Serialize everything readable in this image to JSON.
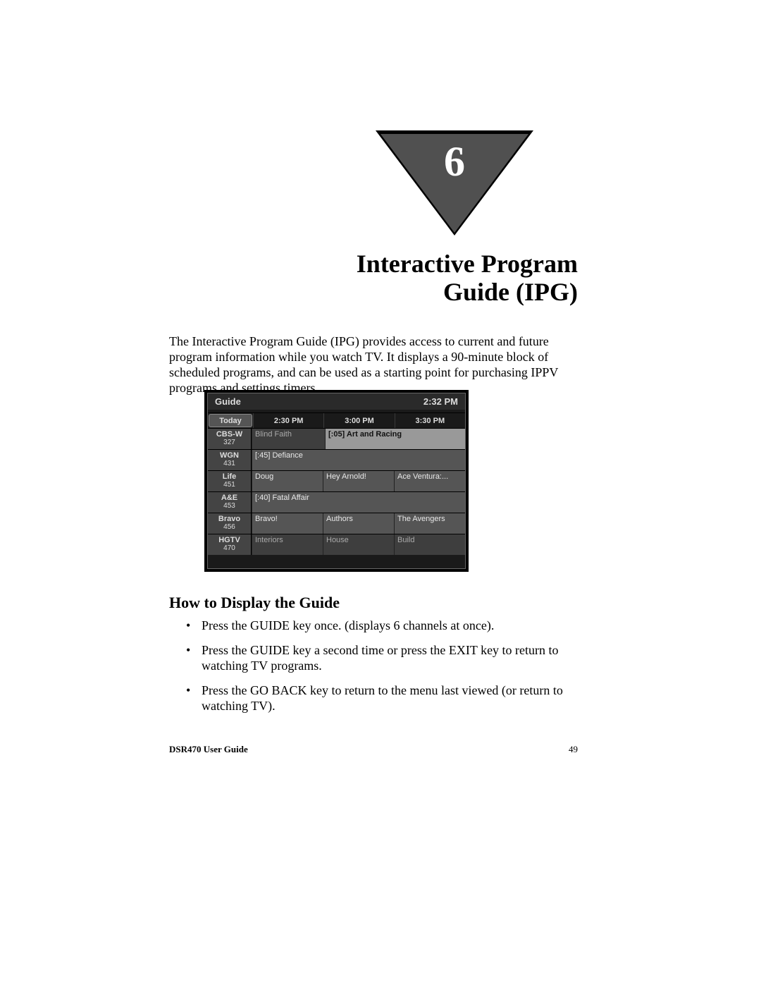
{
  "chapter": {
    "number": "6",
    "title_line1": "Interactive Program",
    "title_line2": "Guide (IPG)"
  },
  "intro_paragraph": "The Interactive Program Guide (IPG) provides access to current and future program information while you watch TV. It displays a 90-minute block of scheduled programs, and can be used as a starting point for purchasing IPPV programs and settings timers.",
  "guide": {
    "title": "Guide",
    "clock": "2:32 PM",
    "today_label": "Today",
    "time_headers": [
      "2:30 PM",
      "3:00 PM",
      "3:30 PM"
    ],
    "channels": [
      {
        "name": "CBS-W",
        "num": "327",
        "programs": [
          {
            "title": "Blind Faith",
            "span": 1,
            "style": "dim"
          },
          {
            "title": "[:05] Art and Racing",
            "span": 2,
            "style": "hilite"
          }
        ]
      },
      {
        "name": "WGN",
        "num": "431",
        "programs": [
          {
            "title": "[:45] Defiance",
            "span": 3,
            "style": ""
          }
        ]
      },
      {
        "name": "Life",
        "num": "451",
        "programs": [
          {
            "title": "Doug",
            "span": 1,
            "style": ""
          },
          {
            "title": "Hey Arnold!",
            "span": 1,
            "style": ""
          },
          {
            "title": "Ace Ventura:...",
            "span": 1,
            "style": ""
          }
        ]
      },
      {
        "name": "A&E",
        "num": "453",
        "programs": [
          {
            "title": "[:40] Fatal Affair",
            "span": 3,
            "style": ""
          }
        ]
      },
      {
        "name": "Bravo",
        "num": "456",
        "programs": [
          {
            "title": "Bravo!",
            "span": 1,
            "style": ""
          },
          {
            "title": "Authors",
            "span": 1,
            "style": ""
          },
          {
            "title": "The Avengers",
            "span": 1,
            "style": ""
          }
        ]
      },
      {
        "name": "HGTV",
        "num": "470",
        "programs": [
          {
            "title": "Interiors",
            "span": 1,
            "style": "dim"
          },
          {
            "title": "House",
            "span": 1,
            "style": "dim"
          },
          {
            "title": "Build",
            "span": 1,
            "style": "dim"
          }
        ]
      }
    ]
  },
  "section": {
    "heading": "How to Display the Guide",
    "bullets": [
      "Press the GUIDE key once. (displays 6 channels at once).",
      "Press the GUIDE key a second time or press the EXIT key to return to watching TV programs.",
      "Press the GO BACK key to return to the menu last viewed (or return to watching TV)."
    ]
  },
  "footer": {
    "left": "DSR470 User Guide",
    "right": "49"
  }
}
